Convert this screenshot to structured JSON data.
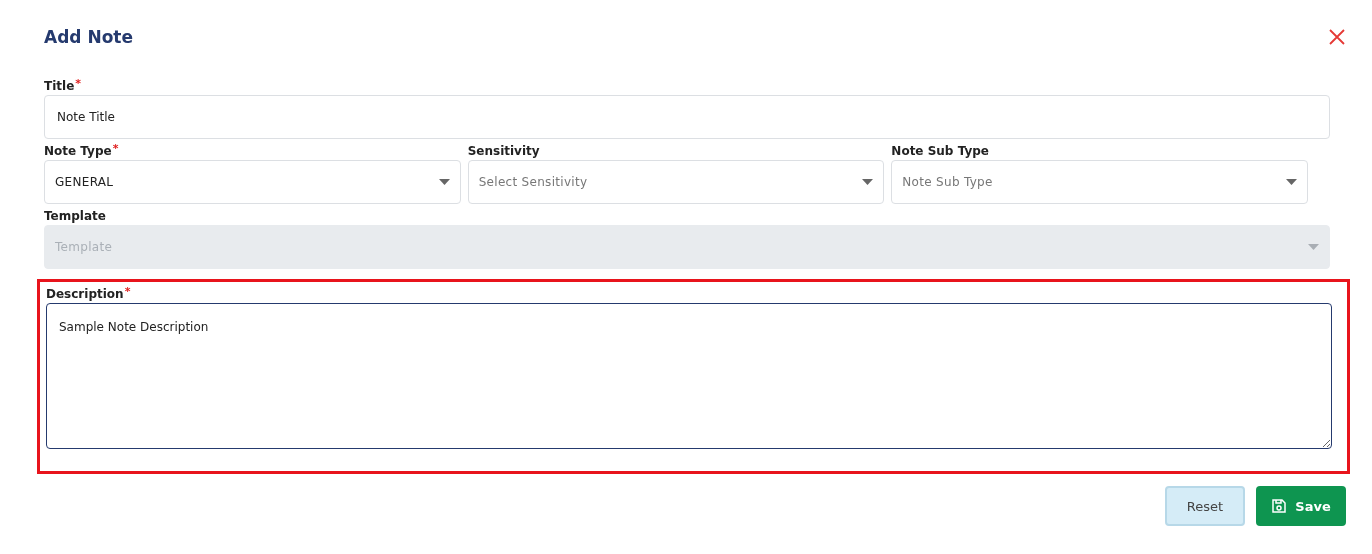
{
  "dialog": {
    "title": "Add Note"
  },
  "title_field": {
    "label": "Title$^{*}$",
    "value": "Note Title"
  },
  "selects": [
    {
      "label": "Note Type$^{*}$",
      "value": "GENERAL"
    },
    {
      "label": "Sensitivity",
      "placeholder": "Select Sensitivity"
    },
    {
      "label": "Note Sub Type",
      "placeholder": "Note Sub Type"
    }
  ],
  "template": {
    "label": "Template",
    "placeholder": "Template",
    "disabled": true
  },
  "description": {
    "label": "Description$^{*}$",
    "value": "Sample Note Description",
    "highlighted": true
  },
  "buttons": [
    {
      "kind": "reset",
      "label": "Reset"
    },
    {
      "kind": "save",
      "label": "Save"
    }
  ]
}
